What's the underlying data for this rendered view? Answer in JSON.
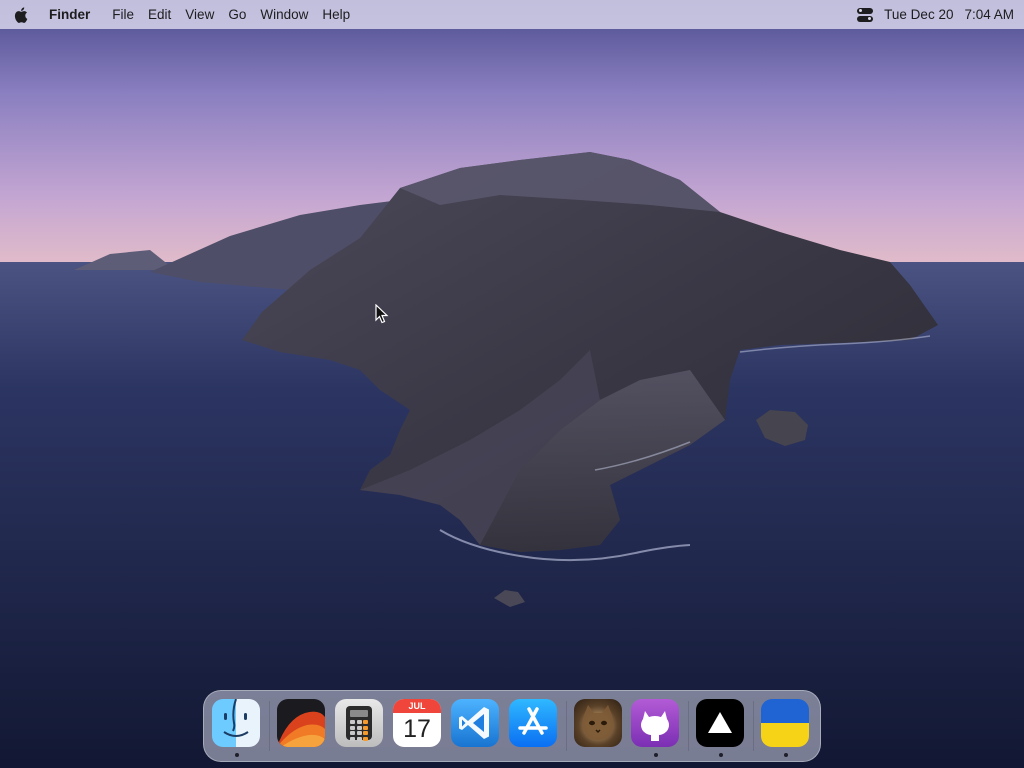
{
  "menubar": {
    "apple_icon": "apple-logo-icon",
    "app_name": "Finder",
    "items": [
      "File",
      "Edit",
      "View",
      "Go",
      "Window",
      "Help"
    ],
    "control_center_icon": "control-center-icon",
    "date": "Tue Dec 20",
    "time": "7:04 AM"
  },
  "desktop": {
    "wallpaper": "island-sunset-wallpaper"
  },
  "dock": {
    "apps": [
      {
        "name": "Finder",
        "icon": "finder-icon",
        "running": true
      },
      {
        "name": "Ventura",
        "icon": "ventura-wallpaper-icon",
        "running": false
      },
      {
        "name": "Calculator",
        "icon": "calculator-icon",
        "running": false
      },
      {
        "name": "Calendar",
        "icon": "calendar-icon",
        "running": false,
        "month": "JUL",
        "day": "17"
      },
      {
        "name": "Visual Studio Code",
        "icon": "vscode-icon",
        "running": false
      },
      {
        "name": "App Store",
        "icon": "app-store-icon",
        "running": false
      },
      {
        "name": "Photo",
        "icon": "cat-photo-icon",
        "running": false
      },
      {
        "name": "GitHub Desktop",
        "icon": "github-icon",
        "running": true
      },
      {
        "name": "Vercel",
        "icon": "vercel-triangle-icon",
        "running": true
      },
      {
        "name": "Ukraine",
        "icon": "ukraine-flag-icon",
        "running": true
      }
    ]
  },
  "colors": {
    "menubar_bg": "#dedcf0",
    "dock_bg": "#cdd0e1",
    "sky_top": "#3f3f7e",
    "sky_horizon": "#d8b8d8",
    "sea": "#1d2447"
  }
}
